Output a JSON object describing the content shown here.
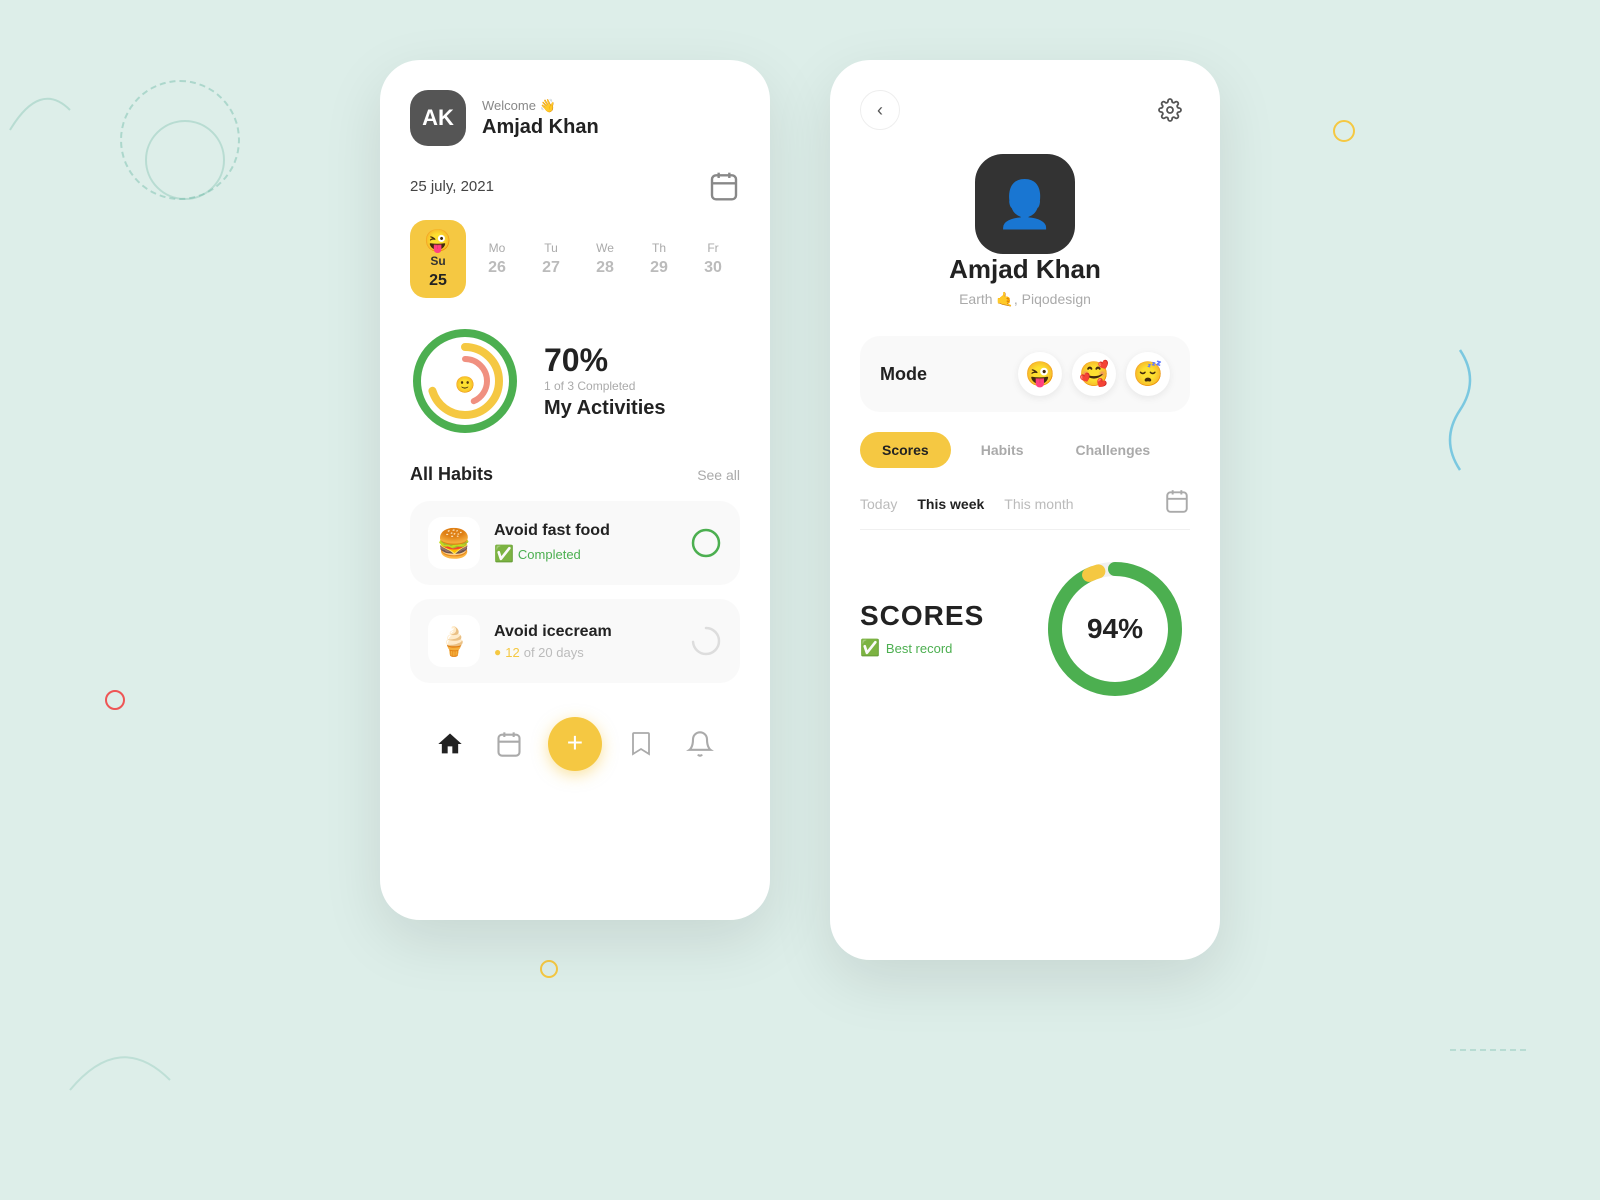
{
  "background": {
    "color": "#ddeee9"
  },
  "left_card": {
    "welcome_label": "Welcome 👋",
    "user_name": "Amjad Khan",
    "date": "25 july, 2021",
    "calendar_days": [
      {
        "name": "Su",
        "num": "25",
        "selected": true
      },
      {
        "name": "Mo",
        "num": "26",
        "selected": false
      },
      {
        "name": "Tu",
        "num": "27",
        "selected": false
      },
      {
        "name": "We",
        "num": "28",
        "selected": false
      },
      {
        "name": "Th",
        "num": "29",
        "selected": false
      },
      {
        "name": "Fr",
        "num": "30",
        "selected": false,
        "muted": true
      }
    ],
    "activities": {
      "percentage": "70%",
      "completed_text": "1 of 3 Completed",
      "title": "My Activities"
    },
    "all_habits_title": "All Habits",
    "see_all_label": "See all",
    "habits": [
      {
        "emoji": "🍔",
        "name": "Avoid fast food",
        "status": "Completed",
        "status_type": "completed"
      },
      {
        "emoji": "🍦",
        "name": "Avoid icecream",
        "progress_current": "12",
        "progress_total": "20",
        "progress_unit": "days",
        "status_type": "progress"
      }
    ],
    "bottom_nav": {
      "plus_label": "+"
    }
  },
  "right_card": {
    "user_name": "Amjad Khan",
    "subtitle": "Earth 🤙, Piqodesign",
    "mode_label": "Mode",
    "mode_emojis": [
      "😜",
      "🥰",
      "😴"
    ],
    "tabs": [
      {
        "label": "Scores",
        "active": true
      },
      {
        "label": "Habits",
        "active": false
      },
      {
        "label": "Challenges",
        "active": false
      }
    ],
    "time_filters": [
      {
        "label": "Today",
        "active": false
      },
      {
        "label": "This week",
        "active": true
      },
      {
        "label": "This month",
        "active": false
      }
    ],
    "scores": {
      "title": "SCORES",
      "best_record": "Best record",
      "percentage": "94%"
    }
  }
}
